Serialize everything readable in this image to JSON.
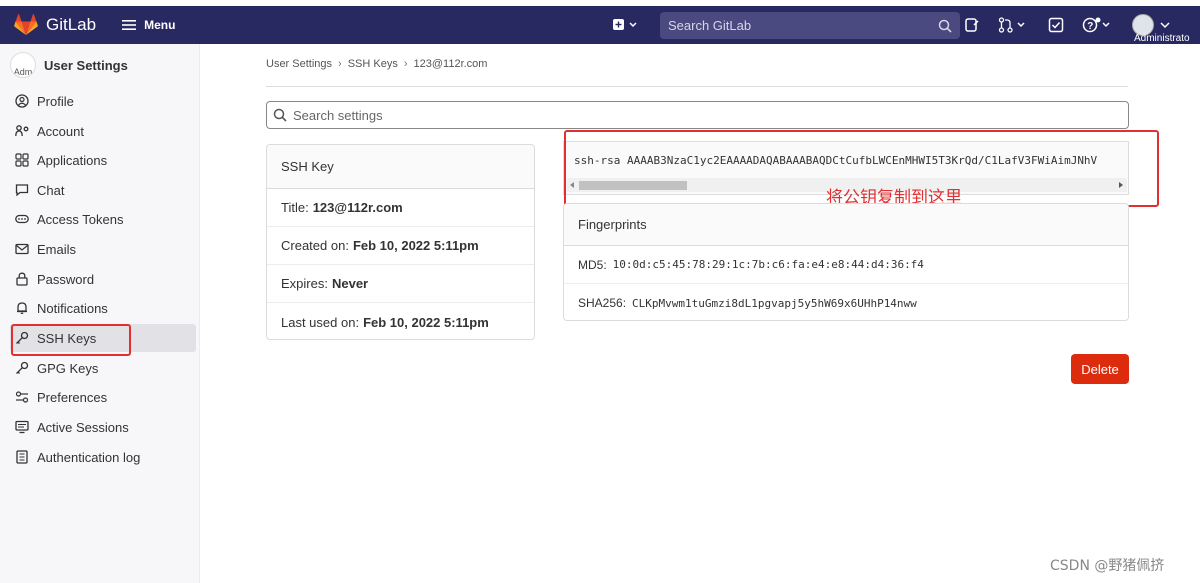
{
  "navbar": {
    "brand": "GitLab",
    "menu_label": "Menu",
    "search_placeholder": "Search GitLab",
    "admin_label": "Administrato"
  },
  "sidebar": {
    "avatar_text": "Adm",
    "title": "User Settings",
    "items": [
      {
        "label": "Profile",
        "icon": "profile-icon"
      },
      {
        "label": "Account",
        "icon": "account-icon"
      },
      {
        "label": "Applications",
        "icon": "applications-icon"
      },
      {
        "label": "Chat",
        "icon": "chat-icon"
      },
      {
        "label": "Access Tokens",
        "icon": "token-icon"
      },
      {
        "label": "Emails",
        "icon": "mail-icon"
      },
      {
        "label": "Password",
        "icon": "lock-icon"
      },
      {
        "label": "Notifications",
        "icon": "bell-icon"
      },
      {
        "label": "SSH Keys",
        "icon": "key-icon"
      },
      {
        "label": "GPG Keys",
        "icon": "key-icon"
      },
      {
        "label": "Preferences",
        "icon": "preferences-icon"
      },
      {
        "label": "Active Sessions",
        "icon": "monitor-icon"
      },
      {
        "label": "Authentication log",
        "icon": "log-icon"
      }
    ]
  },
  "breadcrumb": {
    "items": [
      "User Settings",
      "SSH Keys",
      "123@112r.com"
    ]
  },
  "settings_search": {
    "placeholder": "Search settings"
  },
  "ssh_card": {
    "header": "SSH Key",
    "title_label": "Title:",
    "title_value": "123@112r.com",
    "created_label": "Created on:",
    "created_value": "Feb 10, 2022 5:11pm",
    "expires_label": "Expires:",
    "expires_value": "Never",
    "last_used_label": "Last used on:",
    "last_used_value": "Feb 10, 2022 5:11pm"
  },
  "key": {
    "text": "ssh-rsa AAAAB3NzaC1yc2EAAAADAQABAAABAQDCtCufbLWCEnMHWI5T3KrQd/C1LafV3FWiAimJNhV"
  },
  "annotation": "将公钥复制到这里",
  "fingerprints": {
    "header": "Fingerprints",
    "md5_label": "MD5:",
    "md5_value": "10:0d:c5:45:78:29:1c:7b:c6:fa:e4:e8:44:d4:36:f4",
    "sha_label": "SHA256:",
    "sha_value": "CLKpMvwm1tuGmzi8dL1pgvapj5y5hW69x6UHhP14nww"
  },
  "delete_label": "Delete",
  "watermark": "CSDN @野猪佩挤",
  "colors": {
    "navbar": "#292961",
    "danger": "#dd2b0e",
    "highlight": "#e03030"
  }
}
